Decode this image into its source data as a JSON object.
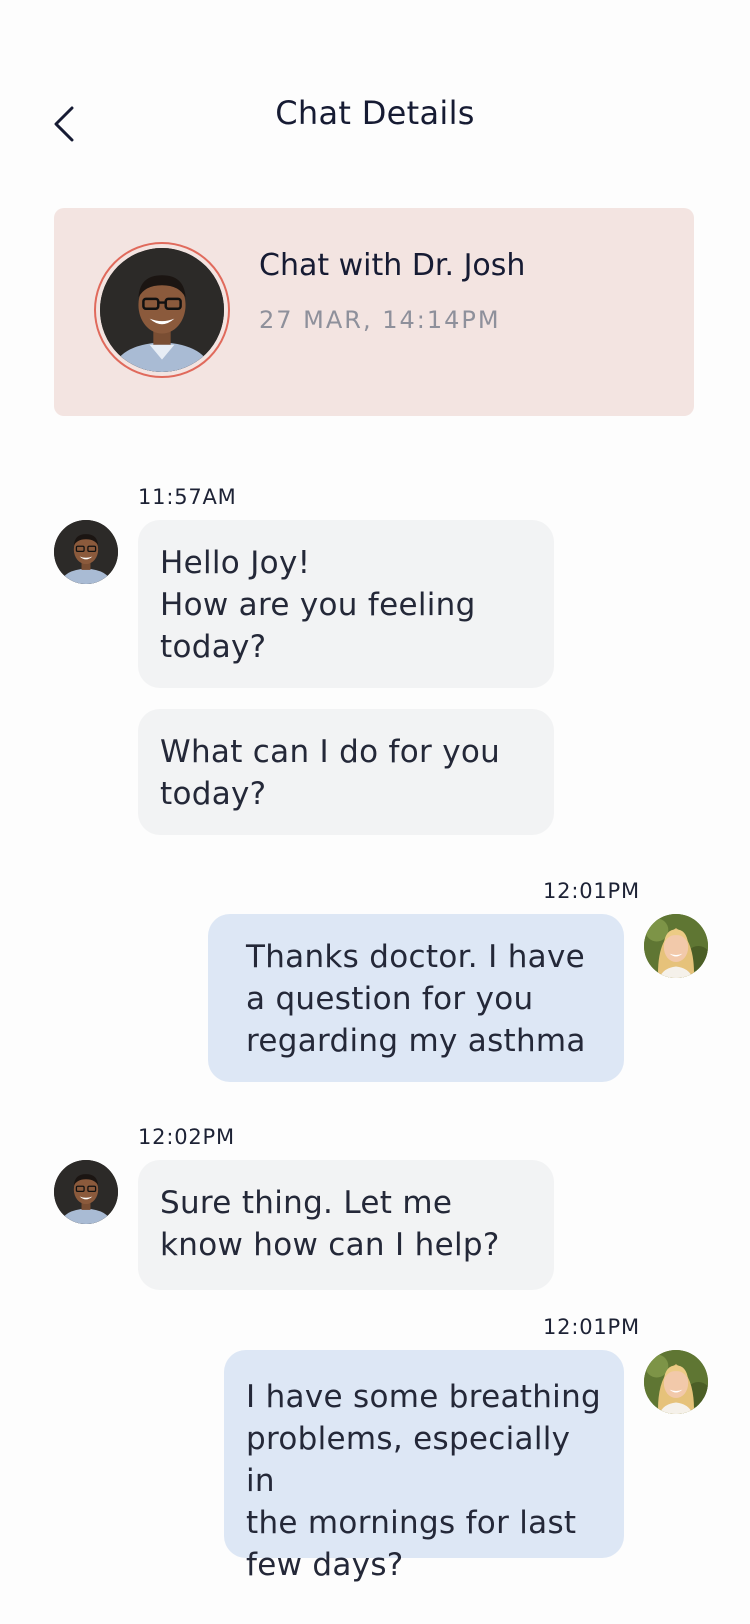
{
  "header": {
    "title": "Chat Details"
  },
  "chat_card": {
    "title": "Chat with Dr. Josh",
    "datetime": "27 MAR, 14:14PM"
  },
  "messages": [
    {
      "sender": "doctor",
      "time": "11:57AM",
      "lines": [
        "Hello Joy!",
        "How are you feeling",
        "today?"
      ]
    },
    {
      "sender": "doctor",
      "time": "",
      "lines": [
        "What can I do for you",
        "today?"
      ]
    },
    {
      "sender": "user",
      "time": "12:01PM",
      "lines": [
        "Thanks doctor. I have",
        "a question for you",
        "regarding my asthma"
      ]
    },
    {
      "sender": "doctor",
      "time": "12:02PM",
      "lines": [
        "Sure thing. Let me",
        "know how can I help?"
      ]
    },
    {
      "sender": "user",
      "time": "12:01PM",
      "lines": [
        "I have some breathing",
        "problems, especially in",
        "the mornings for last",
        "few days?"
      ]
    }
  ],
  "colors": {
    "card_bg": "#f3e4e1",
    "avatar_ring": "#e06a5c",
    "incoming_bubble": "#f2f3f4",
    "outgoing_bubble": "#dde7f5"
  }
}
